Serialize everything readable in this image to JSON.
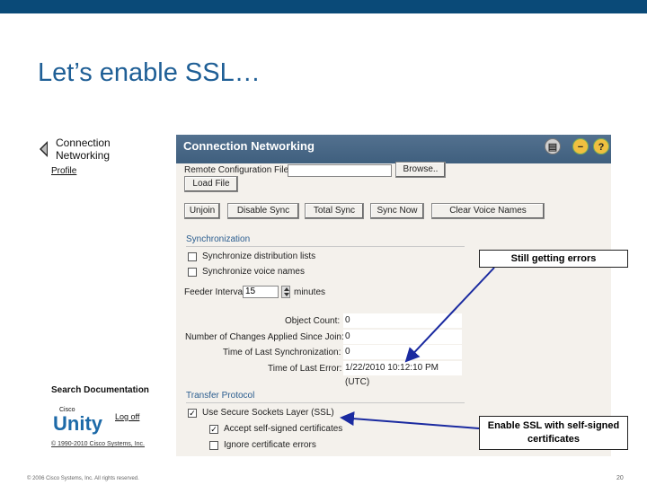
{
  "slide": {
    "title": "Let’s enable SSL…",
    "footer_copyright": "© 2006 Cisco Systems, Inc. All rights reserved.",
    "page_number": "20"
  },
  "nav": {
    "title": "Connection Networking",
    "profile_link": "Profile",
    "search_docs": "Search Documentation",
    "cisco_label": "Cisco",
    "unity_logo": "Unity",
    "log_off": "Log off",
    "copyright": "© 1990-2010 Cisco Systems, Inc."
  },
  "panel": {
    "title": "Connection Networking",
    "remote_config_label": "Remote Configuration File",
    "remote_config_value": "",
    "browse_button": "Browse..",
    "load_file_button": "Load File",
    "buttons": [
      "Unjoin",
      "Disable Sync",
      "Total Sync",
      "Sync Now",
      "Clear Voice Names"
    ],
    "sync_section": "Synchronization",
    "sync_dist_lists": "Synchronize distribution lists",
    "sync_voice_names": "Synchronize voice names",
    "feeder_interval_label": "Feeder Interval",
    "feeder_interval_value": "15",
    "feeder_units": "minutes",
    "object_count_label": "Object Count:",
    "object_count_value": "0",
    "changes_label": "Number of Changes Applied Since Join:",
    "changes_value": "0",
    "last_sync_label": "Time of Last Synchronization:",
    "last_sync_value": "0",
    "last_error_label": "Time of Last Error:",
    "last_error_value": "1/22/2010 10:12:10 PM (UTC)",
    "transfer_section": "Transfer Protocol",
    "use_ssl": "Use Secure Sockets Layer (SSL)",
    "use_ssl_checked": true,
    "accept_self_signed": "Accept self-signed certificates",
    "accept_self_signed_checked": true,
    "ignore_cert_errors": "Ignore certificate errors",
    "ignore_cert_errors_checked": false,
    "sync_dist_lists_checked": false,
    "sync_voice_names_checked": false
  },
  "callouts": {
    "errors": "Still getting errors",
    "enable_ssl": "Enable SSL with self-signed certificates"
  },
  "colors": {
    "top_bar": "#0a4a78",
    "title": "#1f5f96",
    "panel_header": "#4a6a8a",
    "arrow": "#1a2aa0"
  }
}
